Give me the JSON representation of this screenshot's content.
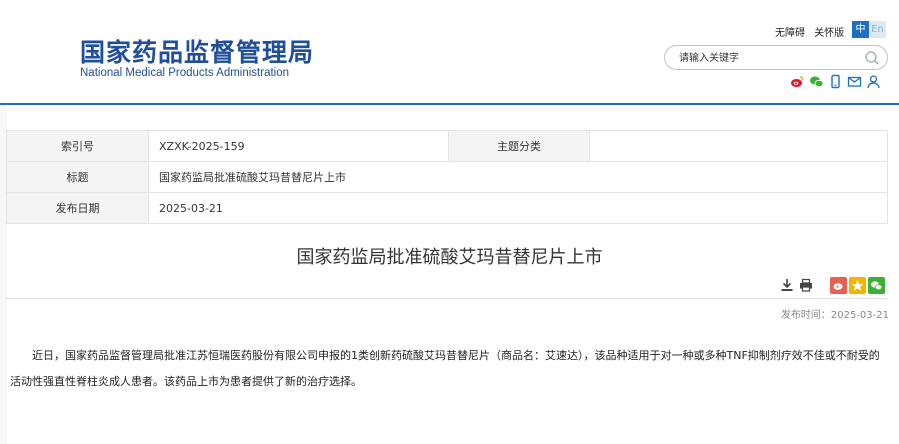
{
  "header": {
    "logo_cn": "国家药品监督管理局",
    "logo_en": "National Medical Products Administration",
    "accessibility_link": "无障碍",
    "care_link": "关怀版",
    "lang_zh": "中",
    "lang_en": "En",
    "search_placeholder": "请输入关键字",
    "social_icons": [
      "weibo-icon",
      "wechat-icon",
      "mobile-icon",
      "mail-icon",
      "user-icon"
    ]
  },
  "meta": {
    "index_label": "索引号",
    "index_value": "XZXK-2025-159",
    "topic_label": "主题分类",
    "topic_value": "",
    "title_label": "标题",
    "title_value": "国家药监局批准硫酸艾玛昔替尼片上市",
    "date_label": "发布日期",
    "date_value": "2025-03-21"
  },
  "article": {
    "title": "国家药监局批准硫酸艾玛昔替尼片上市",
    "publish_time": "发布时间：2025-03-21",
    "body": "近日，国家药品监督管理局批准江苏恒瑞医药股份有限公司申报的1类创新药硫酸艾玛昔替尼片（商品名：艾速达），该品种适用于对一种或多种TNF抑制剂疗效不佳或不耐受的活动性强直性脊柱炎成人患者。该药品上市为患者提供了新的治疗选择。"
  },
  "colors": {
    "brand_blue": "#1f4e9c",
    "accent_blue": "#1f6fc4",
    "weibo_red": "#e6162d",
    "wechat_green": "#3cb034",
    "qzone_yellow": "#f5b400"
  }
}
